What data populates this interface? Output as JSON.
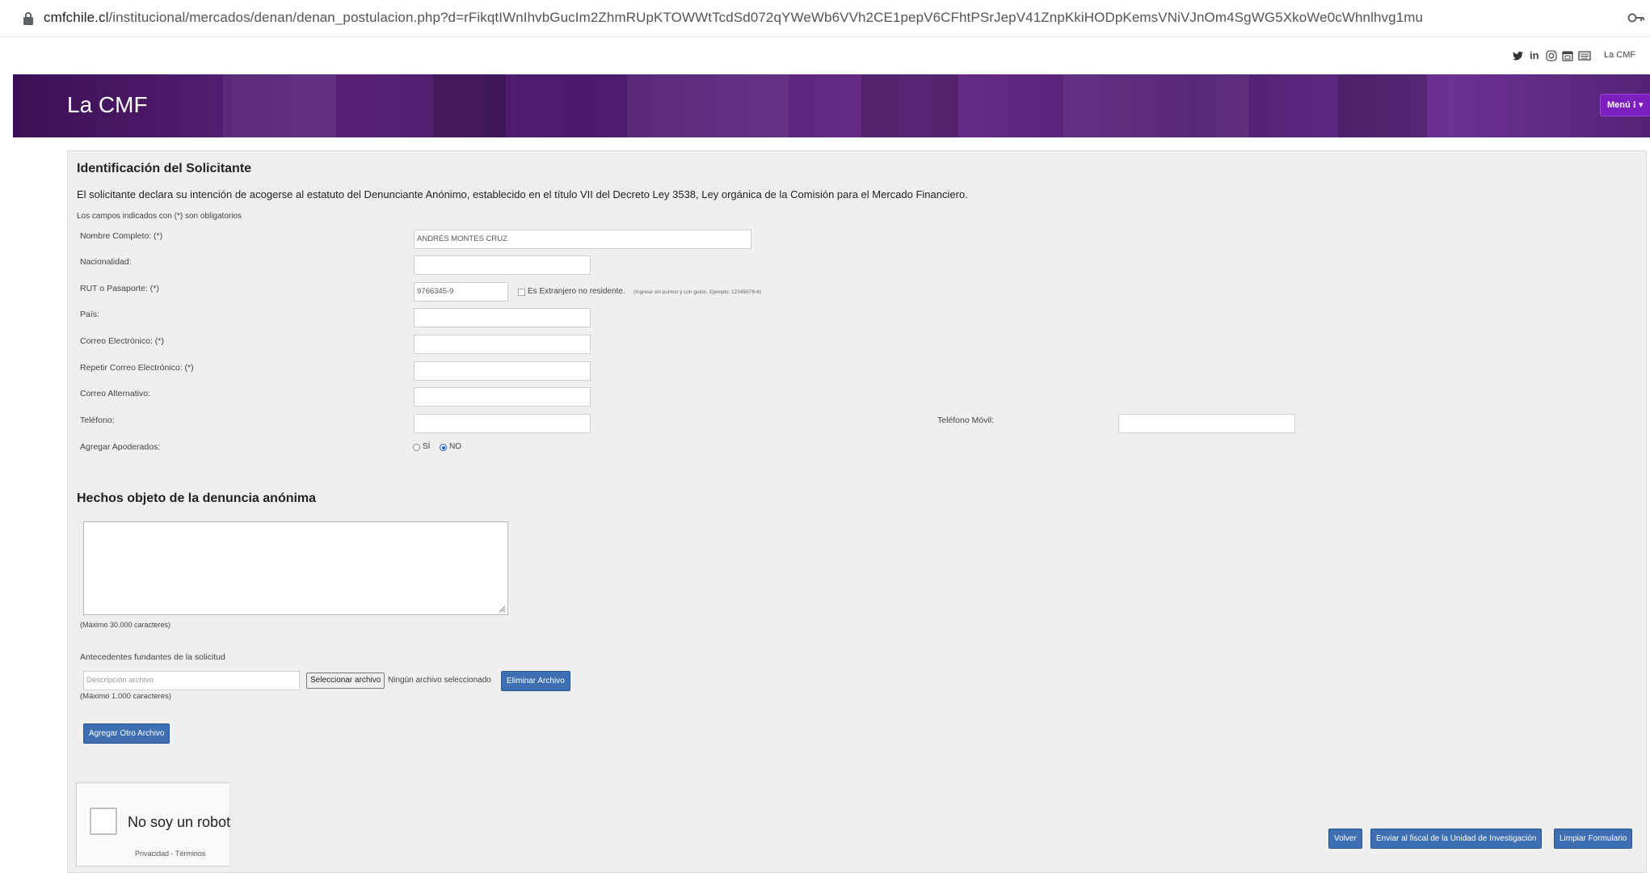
{
  "browser": {
    "url_host": "cmfchile.cl",
    "url_path": "/institucional/mercados/denan/denan_postulacion.php?d=rFikqtIWnIhvbGucIm2ZhmRUpKTOWWtTcdSd072qYWeWb6VVh2CE1pepV6CFhtPSrJepV41ZnpKkiHODpKemsVNiVJnOm4SgWG5XkoWe0cWhnlhvg1mu"
  },
  "topbar": {
    "social_icons": [
      "twitter-icon",
      "linkedin-icon",
      "instagram-icon",
      "calendar-icon",
      "keyboard-icon"
    ],
    "link": "La CMF"
  },
  "header": {
    "title": "La CMF",
    "menu_label": "Menú ⁝ ▾",
    "bg_color": "#4b1a6b",
    "menu_color": "#7d1fbf"
  },
  "form": {
    "section1_title": "Identificación del Solicitante",
    "declaration": "El solicitante declara su intención de acogerse al estatuto del Denunciante Anónimo, establecido en el título VII del Decreto Ley 3538, Ley orgánica de la Comisión para el Mercado Financiero.",
    "required_note": "Los campos indicados con (*) son obligatorios",
    "labels": {
      "nombre": "Nombre Completo: (*)",
      "nacionalidad": "Nacionalidad:",
      "rut": "RUT o Pasaporte: (*)",
      "pais": "País:",
      "correo": "Correo Electrónico: (*)",
      "repetir_correo": "Repetir Correo Electrónico: (*)",
      "correo_alt": "Correo Alternativo:",
      "telefono": "Teléfono:",
      "telefono_movil": "Teléfono Móvil:",
      "apoderados": "Agregar Apoderados:"
    },
    "values": {
      "nombre": "ANDRÉS  MONTES CRUZ",
      "nacionalidad": "",
      "rut": "9766345-9",
      "pais": "",
      "correo": "",
      "repetir_correo": "",
      "correo_alt": "",
      "telefono": "",
      "telefono_movil": ""
    },
    "extranjero_label": "Es Extranjero no residente.",
    "rut_hint": "(Ingrese sin puntos y con guión, Ejemplo: 12345678-6)",
    "apoderados_options": [
      "SÍ",
      "NO"
    ],
    "apoderados_selected": "NO",
    "section2_title": "Hechos objeto de la denuncia anónima",
    "hechos_max": "(Máximo 30.000 caracteres)",
    "antecedentes_label": "Antecedentes fundantes de la solicitud",
    "archivo_placeholder": "Descripción archivo",
    "seleccionar_label": "Seleccionar archivo",
    "ningun_archivo": "Ningún archivo seleccionado",
    "eliminar_label": "Eliminar Archivo",
    "archivo_max": "(Máximo 1.000 caracteres)",
    "agregar_label": "Agregar Otro Archivo"
  },
  "captcha": {
    "label": "No soy un robot",
    "links": "Privacidad - Términos"
  },
  "actions": {
    "volver": "Volver",
    "enviar": "Enviar al fiscal de la Unidad de Investigación",
    "limpiar": "Limpiar Formulario",
    "button_color": "#3e6fb3"
  }
}
